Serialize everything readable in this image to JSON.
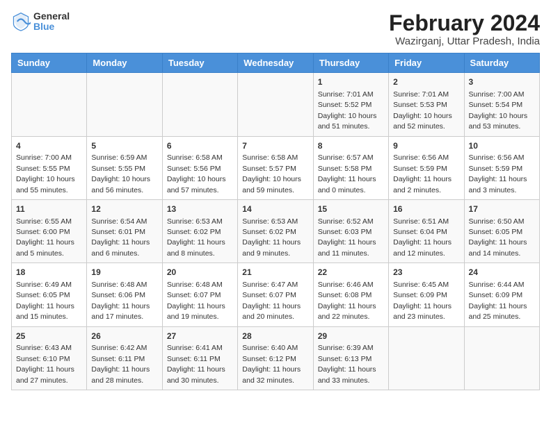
{
  "logo": {
    "line1": "General",
    "line2": "Blue"
  },
  "title": "February 2024",
  "location": "Wazirganj, Uttar Pradesh, India",
  "headers": [
    "Sunday",
    "Monday",
    "Tuesday",
    "Wednesday",
    "Thursday",
    "Friday",
    "Saturday"
  ],
  "weeks": [
    [
      {
        "day": "",
        "sunrise": "",
        "sunset": "",
        "daylight": ""
      },
      {
        "day": "",
        "sunrise": "",
        "sunset": "",
        "daylight": ""
      },
      {
        "day": "",
        "sunrise": "",
        "sunset": "",
        "daylight": ""
      },
      {
        "day": "",
        "sunrise": "",
        "sunset": "",
        "daylight": ""
      },
      {
        "day": "1",
        "sunrise": "Sunrise: 7:01 AM",
        "sunset": "Sunset: 5:52 PM",
        "daylight": "Daylight: 10 hours and 51 minutes."
      },
      {
        "day": "2",
        "sunrise": "Sunrise: 7:01 AM",
        "sunset": "Sunset: 5:53 PM",
        "daylight": "Daylight: 10 hours and 52 minutes."
      },
      {
        "day": "3",
        "sunrise": "Sunrise: 7:00 AM",
        "sunset": "Sunset: 5:54 PM",
        "daylight": "Daylight: 10 hours and 53 minutes."
      }
    ],
    [
      {
        "day": "4",
        "sunrise": "Sunrise: 7:00 AM",
        "sunset": "Sunset: 5:55 PM",
        "daylight": "Daylight: 10 hours and 55 minutes."
      },
      {
        "day": "5",
        "sunrise": "Sunrise: 6:59 AM",
        "sunset": "Sunset: 5:55 PM",
        "daylight": "Daylight: 10 hours and 56 minutes."
      },
      {
        "day": "6",
        "sunrise": "Sunrise: 6:58 AM",
        "sunset": "Sunset: 5:56 PM",
        "daylight": "Daylight: 10 hours and 57 minutes."
      },
      {
        "day": "7",
        "sunrise": "Sunrise: 6:58 AM",
        "sunset": "Sunset: 5:57 PM",
        "daylight": "Daylight: 10 hours and 59 minutes."
      },
      {
        "day": "8",
        "sunrise": "Sunrise: 6:57 AM",
        "sunset": "Sunset: 5:58 PM",
        "daylight": "Daylight: 11 hours and 0 minutes."
      },
      {
        "day": "9",
        "sunrise": "Sunrise: 6:56 AM",
        "sunset": "Sunset: 5:59 PM",
        "daylight": "Daylight: 11 hours and 2 minutes."
      },
      {
        "day": "10",
        "sunrise": "Sunrise: 6:56 AM",
        "sunset": "Sunset: 5:59 PM",
        "daylight": "Daylight: 11 hours and 3 minutes."
      }
    ],
    [
      {
        "day": "11",
        "sunrise": "Sunrise: 6:55 AM",
        "sunset": "Sunset: 6:00 PM",
        "daylight": "Daylight: 11 hours and 5 minutes."
      },
      {
        "day": "12",
        "sunrise": "Sunrise: 6:54 AM",
        "sunset": "Sunset: 6:01 PM",
        "daylight": "Daylight: 11 hours and 6 minutes."
      },
      {
        "day": "13",
        "sunrise": "Sunrise: 6:53 AM",
        "sunset": "Sunset: 6:02 PM",
        "daylight": "Daylight: 11 hours and 8 minutes."
      },
      {
        "day": "14",
        "sunrise": "Sunrise: 6:53 AM",
        "sunset": "Sunset: 6:02 PM",
        "daylight": "Daylight: 11 hours and 9 minutes."
      },
      {
        "day": "15",
        "sunrise": "Sunrise: 6:52 AM",
        "sunset": "Sunset: 6:03 PM",
        "daylight": "Daylight: 11 hours and 11 minutes."
      },
      {
        "day": "16",
        "sunrise": "Sunrise: 6:51 AM",
        "sunset": "Sunset: 6:04 PM",
        "daylight": "Daylight: 11 hours and 12 minutes."
      },
      {
        "day": "17",
        "sunrise": "Sunrise: 6:50 AM",
        "sunset": "Sunset: 6:05 PM",
        "daylight": "Daylight: 11 hours and 14 minutes."
      }
    ],
    [
      {
        "day": "18",
        "sunrise": "Sunrise: 6:49 AM",
        "sunset": "Sunset: 6:05 PM",
        "daylight": "Daylight: 11 hours and 15 minutes."
      },
      {
        "day": "19",
        "sunrise": "Sunrise: 6:48 AM",
        "sunset": "Sunset: 6:06 PM",
        "daylight": "Daylight: 11 hours and 17 minutes."
      },
      {
        "day": "20",
        "sunrise": "Sunrise: 6:48 AM",
        "sunset": "Sunset: 6:07 PM",
        "daylight": "Daylight: 11 hours and 19 minutes."
      },
      {
        "day": "21",
        "sunrise": "Sunrise: 6:47 AM",
        "sunset": "Sunset: 6:07 PM",
        "daylight": "Daylight: 11 hours and 20 minutes."
      },
      {
        "day": "22",
        "sunrise": "Sunrise: 6:46 AM",
        "sunset": "Sunset: 6:08 PM",
        "daylight": "Daylight: 11 hours and 22 minutes."
      },
      {
        "day": "23",
        "sunrise": "Sunrise: 6:45 AM",
        "sunset": "Sunset: 6:09 PM",
        "daylight": "Daylight: 11 hours and 23 minutes."
      },
      {
        "day": "24",
        "sunrise": "Sunrise: 6:44 AM",
        "sunset": "Sunset: 6:09 PM",
        "daylight": "Daylight: 11 hours and 25 minutes."
      }
    ],
    [
      {
        "day": "25",
        "sunrise": "Sunrise: 6:43 AM",
        "sunset": "Sunset: 6:10 PM",
        "daylight": "Daylight: 11 hours and 27 minutes."
      },
      {
        "day": "26",
        "sunrise": "Sunrise: 6:42 AM",
        "sunset": "Sunset: 6:11 PM",
        "daylight": "Daylight: 11 hours and 28 minutes."
      },
      {
        "day": "27",
        "sunrise": "Sunrise: 6:41 AM",
        "sunset": "Sunset: 6:11 PM",
        "daylight": "Daylight: 11 hours and 30 minutes."
      },
      {
        "day": "28",
        "sunrise": "Sunrise: 6:40 AM",
        "sunset": "Sunset: 6:12 PM",
        "daylight": "Daylight: 11 hours and 32 minutes."
      },
      {
        "day": "29",
        "sunrise": "Sunrise: 6:39 AM",
        "sunset": "Sunset: 6:13 PM",
        "daylight": "Daylight: 11 hours and 33 minutes."
      },
      {
        "day": "",
        "sunrise": "",
        "sunset": "",
        "daylight": ""
      },
      {
        "day": "",
        "sunrise": "",
        "sunset": "",
        "daylight": ""
      }
    ]
  ]
}
